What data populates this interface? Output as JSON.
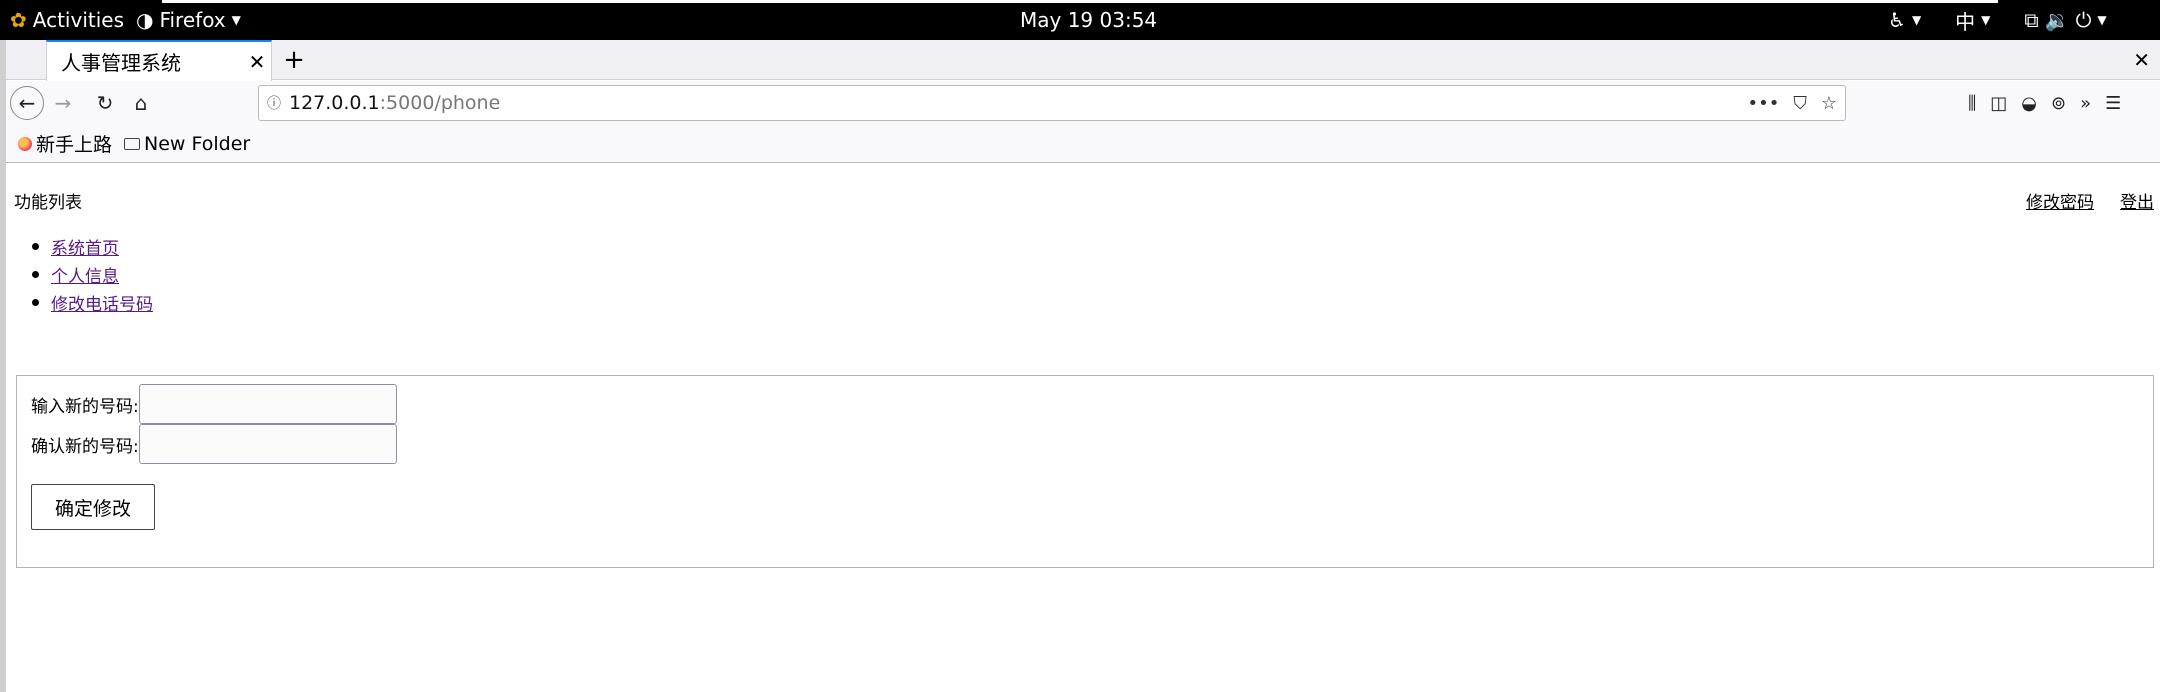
{
  "system_bar": {
    "activities": "Activities",
    "app_name": "Firefox",
    "clock": "May 19  03:54",
    "input_method": "中"
  },
  "browser": {
    "tab_title": "人事管理系统",
    "url_host": "127.0.0.1",
    "url_rest": ":5000/phone",
    "bookmarks": [
      {
        "label": "新手上路",
        "icon": "firefox-icon"
      },
      {
        "label": "New Folder",
        "icon": "folder-icon"
      }
    ]
  },
  "page": {
    "function_list_title": "功能列表",
    "top_links": {
      "change_password": "修改密码",
      "logout": "登出"
    },
    "menu": [
      {
        "label": "系统首页"
      },
      {
        "label": "个人信息"
      },
      {
        "label": "修改电话号码"
      }
    ],
    "form": {
      "new_phone_label": "输入新的号码:",
      "new_phone_value": "",
      "confirm_phone_label": "确认新的号码:",
      "confirm_phone_value": "",
      "submit_label": "确定修改"
    }
  }
}
